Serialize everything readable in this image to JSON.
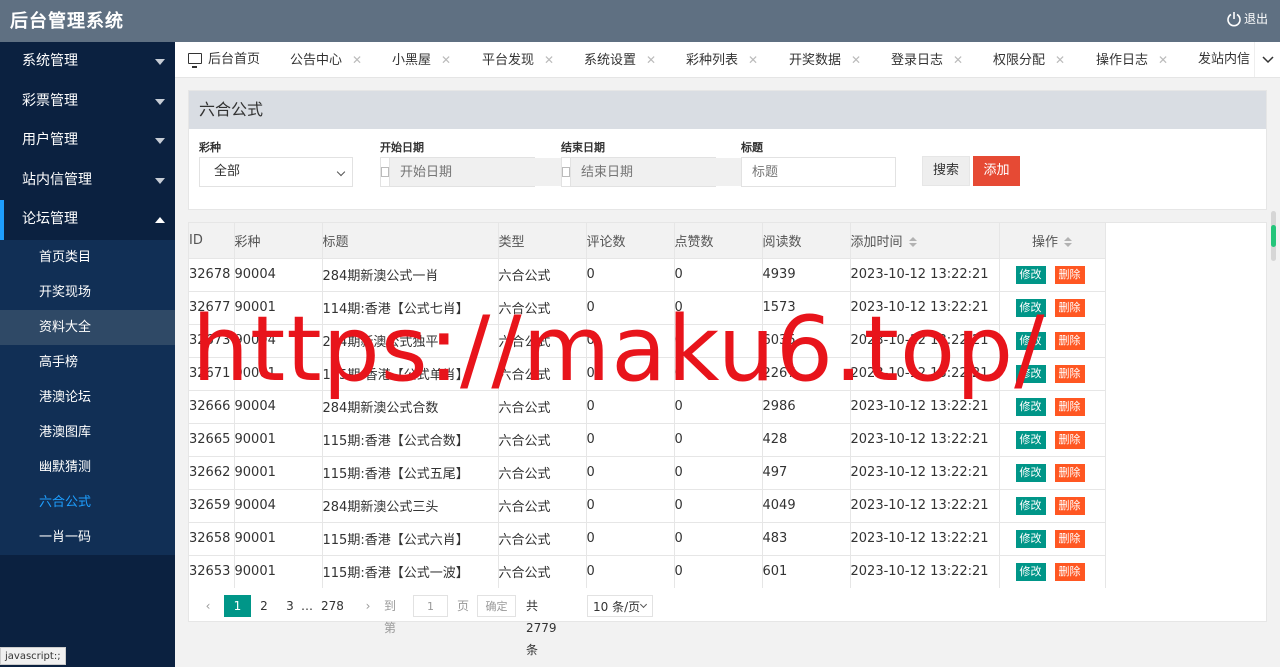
{
  "app": {
    "title": "后台管理系统",
    "logout_label": "退出"
  },
  "sidebar": {
    "groups": [
      {
        "label": "系统管理"
      },
      {
        "label": "彩票管理"
      },
      {
        "label": "用户管理"
      },
      {
        "label": "站内信管理"
      },
      {
        "label": "论坛管理"
      }
    ],
    "forum_items": [
      {
        "label": "首页类目"
      },
      {
        "label": "开奖现场"
      },
      {
        "label": "资料大全"
      },
      {
        "label": "高手榜"
      },
      {
        "label": "港澳论坛"
      },
      {
        "label": "港澳图库"
      },
      {
        "label": "幽默猜测"
      },
      {
        "label": "六合公式"
      },
      {
        "label": "一肖一码"
      }
    ]
  },
  "tabs": [
    {
      "label": "后台首页"
    },
    {
      "label": "公告中心"
    },
    {
      "label": "小黑屋"
    },
    {
      "label": "平台发现"
    },
    {
      "label": "系统设置"
    },
    {
      "label": "彩种列表"
    },
    {
      "label": "开奖数据"
    },
    {
      "label": "登录日志"
    },
    {
      "label": "权限分配"
    },
    {
      "label": "操作日志"
    },
    {
      "label": "发站内信"
    }
  ],
  "filter": {
    "panel_title": "六合公式",
    "lottery_label": "彩种",
    "lottery_value": "全部",
    "start_label": "开始日期",
    "start_placeholder": "开始日期",
    "end_label": "结束日期",
    "end_placeholder": "结束日期",
    "title_label": "标题",
    "title_placeholder": "标题",
    "search_label": "搜索",
    "add_label": "添加"
  },
  "table": {
    "columns": [
      "ID",
      "彩种",
      "标题",
      "类型",
      "评论数",
      "点赞数",
      "阅读数",
      "添加时间",
      "操作"
    ],
    "edit_label": "修改",
    "delete_label": "删除",
    "rows": [
      [
        "32678",
        "90004",
        "284期新澳公式一肖",
        "六合公式",
        "0",
        "0",
        "4939",
        "2023-10-12 13:22:21"
      ],
      [
        "32677",
        "90001",
        "114期:香港【公式七肖】",
        "六合公式",
        "0",
        "0",
        "1573",
        "2023-10-12 13:22:21"
      ],
      [
        "32673",
        "90004",
        "284期新澳公式独平",
        "六合公式",
        "0",
        "0",
        "6035",
        "2023-10-12 13:22:21"
      ],
      [
        "32671",
        "90001",
        "115期:香港【公式单肖】",
        "六合公式",
        "0",
        "0",
        "2267",
        "2023-10-12 13:22:21"
      ],
      [
        "32666",
        "90004",
        "284期新澳公式合数",
        "六合公式",
        "0",
        "0",
        "2986",
        "2023-10-12 13:22:21"
      ],
      [
        "32665",
        "90001",
        "115期:香港【公式合数】",
        "六合公式",
        "0",
        "0",
        "428",
        "2023-10-12 13:22:21"
      ],
      [
        "32662",
        "90001",
        "115期:香港【公式五尾】",
        "六合公式",
        "0",
        "0",
        "497",
        "2023-10-12 13:22:21"
      ],
      [
        "32659",
        "90004",
        "284期新澳公式三头",
        "六合公式",
        "0",
        "0",
        "4049",
        "2023-10-12 13:22:21"
      ],
      [
        "32658",
        "90001",
        "115期:香港【公式六肖】",
        "六合公式",
        "0",
        "0",
        "483",
        "2023-10-12 13:22:21"
      ],
      [
        "32653",
        "90001",
        "115期:香港【公式一波】",
        "六合公式",
        "0",
        "0",
        "601",
        "2023-10-12 13:22:21"
      ]
    ]
  },
  "pager": {
    "current": "1",
    "page2": "2",
    "page3": "3",
    "ellipsis": "…",
    "last": "278",
    "goto_label": "到第",
    "goto_value": "1",
    "page_unit": "页",
    "confirm_label": "确定",
    "total": "共 2779 条",
    "page_size": "10 条/页"
  },
  "status_bar": "javascript:;",
  "watermark": "https://maku6.top/",
  "colors": {
    "topbar": "#5f7082",
    "sidebar": "#0b2140",
    "accent": "#1e9fff",
    "edit": "#009688",
    "delete": "#ff5722",
    "add": "#e64a34"
  }
}
